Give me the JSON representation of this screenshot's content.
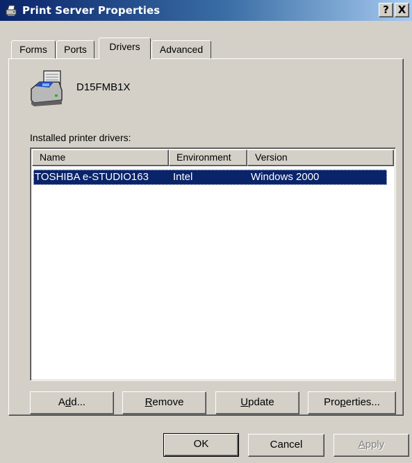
{
  "window": {
    "title": "Print Server Properties",
    "help_label": "?",
    "close_label": "X"
  },
  "tabs": [
    {
      "label": "Forms",
      "active": false
    },
    {
      "label": "Ports",
      "active": false
    },
    {
      "label": "Drivers",
      "active": true
    },
    {
      "label": "Advanced",
      "active": false
    }
  ],
  "server": {
    "name": "D15FMB1X",
    "icon": "printer-server-icon"
  },
  "drivers": {
    "label": "Installed printer drivers:",
    "columns": [
      "Name",
      "Environment",
      "Version"
    ],
    "rows": [
      {
        "name": "TOSHIBA e-STUDIO163",
        "environment": "Intel",
        "version": "Windows 2000",
        "selected": true
      }
    ]
  },
  "panel_buttons": {
    "add": {
      "pre": "A",
      "key": "d",
      "post": "d..."
    },
    "remove": {
      "pre": "",
      "key": "R",
      "post": "emove"
    },
    "update": {
      "pre": "",
      "key": "U",
      "post": "pdate"
    },
    "properties": {
      "pre": "Pro",
      "key": "p",
      "post": "erties..."
    }
  },
  "dialog_buttons": {
    "ok": "OK",
    "cancel": "Cancel",
    "apply": {
      "pre": "",
      "key": "A",
      "post": "pply",
      "disabled": true
    }
  },
  "colors": {
    "title_start": "#0a246a",
    "title_end": "#a6caf0",
    "selection": "#0a246a",
    "face": "#d4d0c8"
  }
}
